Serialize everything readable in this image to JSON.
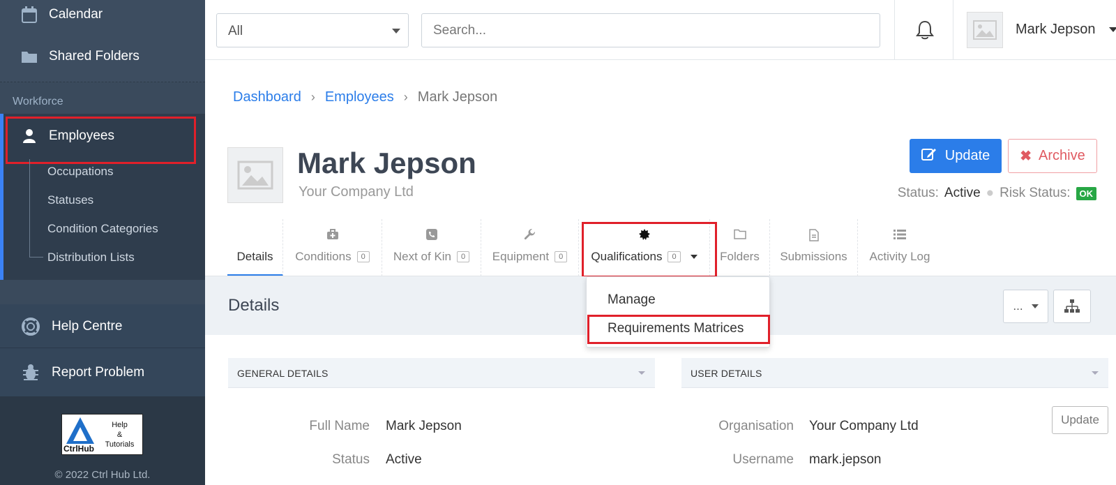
{
  "sidebar": {
    "items": [
      {
        "label": "Calendar",
        "icon": "calendar-icon"
      },
      {
        "label": "Shared Folders",
        "icon": "folder-icon"
      }
    ],
    "section_label": "Workforce",
    "active_item": {
      "label": "Employees",
      "icon": "user-icon"
    },
    "sub_items": [
      "Occupations",
      "Statuses",
      "Condition Categories",
      "Distribution Lists"
    ],
    "help_items": [
      {
        "label": "Help Centre",
        "icon": "lifebuoy-icon"
      },
      {
        "label": "Report Problem",
        "icon": "bug-icon"
      }
    ],
    "logo": {
      "brand": "CtrlHub",
      "line1": "Help",
      "line2": "&",
      "line3": "Tutorials"
    },
    "copyright": "© 2022 Ctrl Hub Ltd."
  },
  "topbar": {
    "filter_value": "All",
    "search_placeholder": "Search...",
    "user_name": "Mark Jepson"
  },
  "breadcrumb": [
    "Dashboard",
    "Employees",
    "Mark Jepson"
  ],
  "employee": {
    "name": "Mark Jepson",
    "company": "Your Company Ltd",
    "update_label": "Update",
    "archive_label": "Archive",
    "status_label": "Status:",
    "status_value": "Active",
    "risk_label": "Risk Status:",
    "risk_value": "OK"
  },
  "tabs": [
    {
      "label": "Details",
      "icon": "",
      "count": null,
      "active": true
    },
    {
      "label": "Conditions",
      "icon": "medkit-icon",
      "count": "0"
    },
    {
      "label": "Next of Kin",
      "icon": "phone-icon",
      "count": "0"
    },
    {
      "label": "Equipment",
      "icon": "wrench-icon",
      "count": "0"
    },
    {
      "label": "Qualifications",
      "icon": "certificate-icon",
      "count": "0",
      "dropdown": true
    },
    {
      "label": "Folders",
      "icon": "folder-icon",
      "count": null
    },
    {
      "label": "Submissions",
      "icon": "document-icon",
      "count": null
    },
    {
      "label": "Activity Log",
      "icon": "list-icon",
      "count": null
    }
  ],
  "dropdown": {
    "items": [
      "Manage",
      "Requirements Matrices"
    ]
  },
  "details": {
    "title": "Details",
    "more_label": "...",
    "general_header": "GENERAL DETAILS",
    "user_header": "USER DETAILS",
    "general_rows": [
      {
        "label": "Full Name",
        "value": "Mark Jepson"
      },
      {
        "label": "Status",
        "value": "Active"
      }
    ],
    "user_rows": [
      {
        "label": "Organisation",
        "value": "Your Company Ltd"
      },
      {
        "label": "Username",
        "value": "mark.jepson"
      }
    ],
    "user_update_label": "Update"
  },
  "colors": {
    "accent": "#2b7de9",
    "highlight": "#e0202a",
    "sidebar": "#3a4a5c",
    "ok": "#28a745"
  }
}
